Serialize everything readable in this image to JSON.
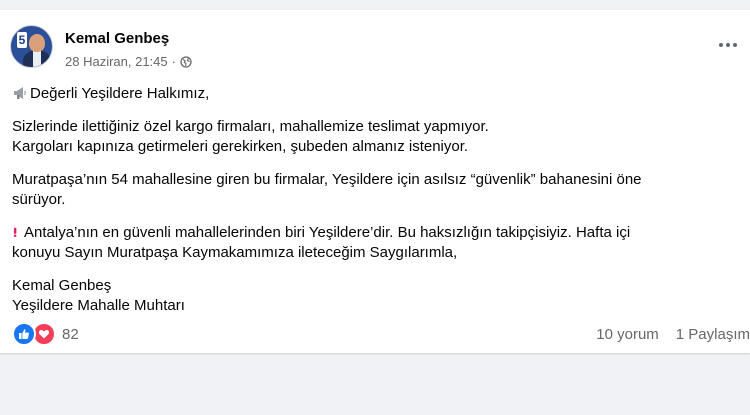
{
  "post": {
    "author": "Kemal Genbeş",
    "date": "28 Haziran, 21:45",
    "separator": "·",
    "privacy_icon": "globe-icon",
    "avatar_badge": "5",
    "paragraphs": [
      [
        "Değerli Yeşildere Halkımız,"
      ],
      [
        "Sizlerinde ilettiğiniz özel kargo firmaları, mahallemize teslimat yapmıyor.",
        "Kargoları kapınıza getirmeleri gerekirken, şubeden almanız isteniyor."
      ],
      [
        "Muratpaşa’nın 54 mahallesine giren bu firmalar, Yeşildere için asılsız “güvenlik” bahanesini öne",
        "sürüyor."
      ],
      [
        "Antalya’nın en güvenli mahallelerinden biri Yeşildere’dir. Bu haksızlığın takipçisiyiz. Hafta içi",
        "konuyu Sayın Muratpaşa Kaymakamımıza ileteceğim Saygılarımla,"
      ],
      [
        "Kemal Genbeş",
        "Yeşildere Mahalle Muhtarı"
      ]
    ]
  },
  "footer": {
    "reaction_count": "82",
    "comments": "10 yorum",
    "shares": "1 Paylaşım"
  },
  "colors": {
    "like": "#1877f2",
    "love": "#f33e58",
    "secondary_text": "#65676b"
  }
}
